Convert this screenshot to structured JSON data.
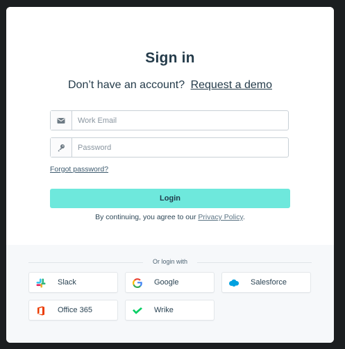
{
  "signin": {
    "title": "Sign in",
    "no_account_text": "Don’t have an account?",
    "request_demo_link": "Request a demo"
  },
  "form": {
    "email": {
      "placeholder": "Work Email",
      "value": "",
      "icon": "envelope-icon"
    },
    "password": {
      "placeholder": "Password",
      "value": "",
      "icon": "key-icon"
    },
    "forgot_password_link": "Forgot password?",
    "login_button": "Login",
    "terms_prefix": "By continuing, you agree to our",
    "privacy_policy_link": "Privacy Policy",
    "terms_suffix": "."
  },
  "sso": {
    "divider_text": "Or login with",
    "providers": [
      {
        "label": "Slack",
        "icon": "slack-icon"
      },
      {
        "label": "Google",
        "icon": "google-icon"
      },
      {
        "label": "Salesforce",
        "icon": "salesforce-icon"
      },
      {
        "label": "Office 365",
        "icon": "office365-icon"
      },
      {
        "label": "Wrike",
        "icon": "wrike-icon"
      }
    ]
  },
  "colors": {
    "login_button": "#6ee8dc",
    "title_text": "#243b4a",
    "background": "#1b1e20",
    "footer_panel": "#f6f8fa"
  }
}
